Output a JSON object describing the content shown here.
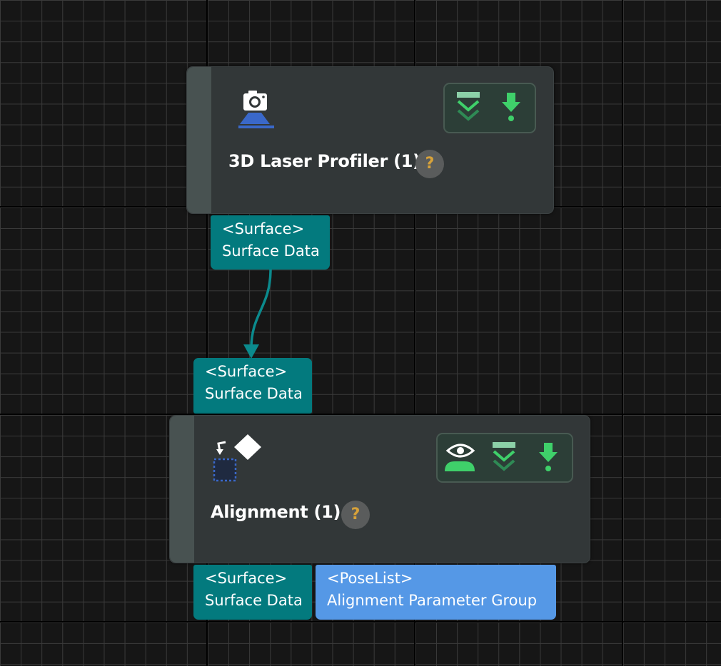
{
  "nodes": [
    {
      "title": "3D Laser Profiler (1)",
      "help": "?",
      "icon": "laser-profiler-camera-icon",
      "toolbar": [
        "debug-expand-icon",
        "download-arrow-icon"
      ],
      "outputs": [
        {
          "type": "<Surface>",
          "name": "Surface Data"
        }
      ]
    },
    {
      "title": "Alignment (1)",
      "help": "?",
      "icon": "alignment-icon",
      "toolbar": [
        "visualize-eye-icon",
        "debug-expand-icon",
        "download-arrow-icon"
      ],
      "inputs": [
        {
          "type": "<Surface>",
          "name": "Surface Data"
        }
      ],
      "outputs": [
        {
          "type": "<Surface>",
          "name": "Surface Data"
        },
        {
          "type": "<PoseList>",
          "name": "Alignment Parameter Group"
        }
      ]
    }
  ],
  "colors": {
    "canvas": "#161616",
    "node": "#323738",
    "surface_port": "#037a7e",
    "poselist_port": "#5598e6",
    "connection": "#0b8a8d",
    "accent_green": "#3fd06a",
    "help_mark": "#d7a23a"
  }
}
